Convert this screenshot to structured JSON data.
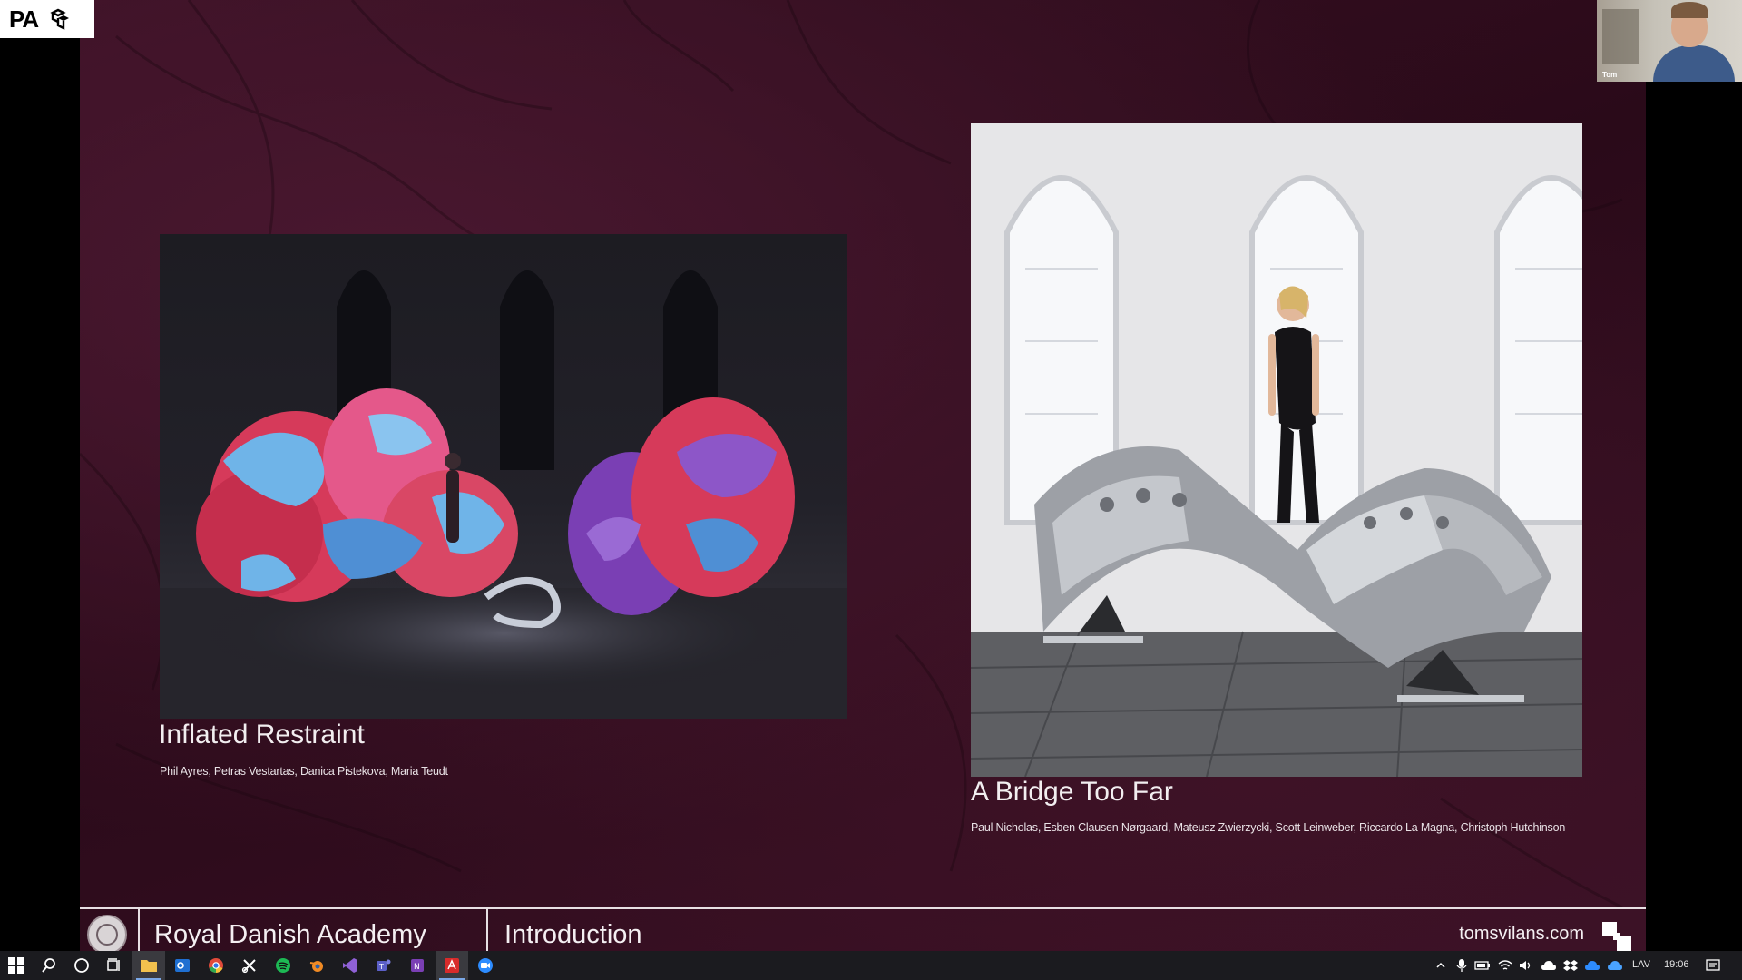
{
  "app_logo": {
    "text": "PA"
  },
  "webcam": {
    "label": "Tom"
  },
  "slide": {
    "left_project": {
      "title": "Inflated Restraint",
      "authors": "Phil Ayres, Petras Vestartas, Danica Pistekova, Maria Teudt"
    },
    "right_project": {
      "title": "A Bridge Too Far",
      "authors": "Paul Nicholas, Esben Clausen Nørgaard, Mateusz Zwierzycki, Scott Leinweber, Riccardo La Magna, Christoph Hutchinson"
    }
  },
  "footer": {
    "organization": "Royal Danish Academy",
    "section": "Introduction",
    "website": "tomsvilans.com"
  },
  "taskbar": {
    "icons": [
      "windows-start",
      "search",
      "cortana",
      "task-view",
      "file-explorer",
      "outlook",
      "chrome",
      "snipping-tool",
      "spotify",
      "blender",
      "visual-studio",
      "teams",
      "onenote",
      "acrobat",
      "zoom"
    ],
    "tray": {
      "language": "LAV",
      "time": "19:06"
    }
  },
  "colors": {
    "slide_bg": "#3a1024",
    "footer_text": "#f4eff2",
    "taskbar_bg": "#1b1b1f"
  }
}
